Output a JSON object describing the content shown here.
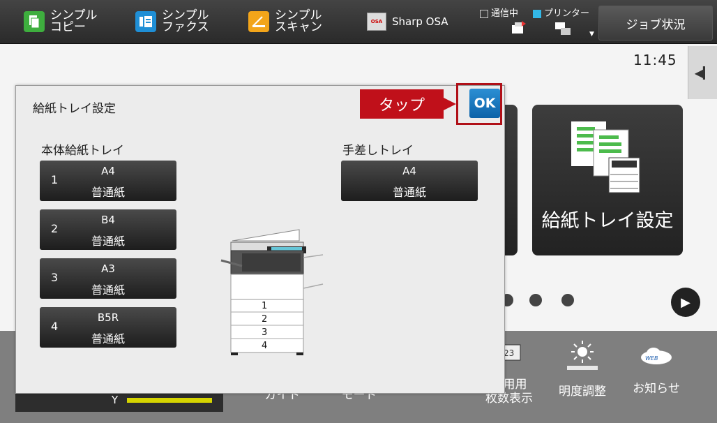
{
  "topbar": {
    "simple_copy": "シンプル\nコピー",
    "simple_fax": "シンプル\nファクス",
    "simple_scan": "シンプル\nスキャン",
    "osa": "Sharp OSA",
    "osa_logo": "OSA",
    "status_comm": "通信中",
    "status_printer": "プリンター",
    "job_status": "ジョブ状況"
  },
  "home": {
    "clock": "11:45",
    "tile_label": "給紙トレイ設定"
  },
  "bottom": {
    "toner_label": "Y",
    "items": [
      "ガイド",
      "モード",
      "使用用\n枚数表示",
      "明度調整",
      "お知らせ"
    ]
  },
  "dialog": {
    "title": "給紙トレイ設定",
    "main_trays_label": "本体給紙トレイ",
    "bypass_label": "手差しトレイ",
    "trays": [
      {
        "num": "1",
        "size": "A4",
        "type": "普通紙"
      },
      {
        "num": "2",
        "size": "B4",
        "type": "普通紙"
      },
      {
        "num": "3",
        "size": "A3",
        "type": "普通紙"
      },
      {
        "num": "4",
        "size": "B5R",
        "type": "普通紙"
      }
    ],
    "bypass": {
      "size": "A4",
      "type": "普通紙"
    },
    "printer_tray_numbers": [
      "1",
      "2",
      "3",
      "4"
    ],
    "ok": "OK"
  },
  "callout": {
    "text": "タップ"
  },
  "colors": {
    "callout": "#c0101a",
    "ok": "#1573bd",
    "toner_yellow": "#d5d400"
  }
}
